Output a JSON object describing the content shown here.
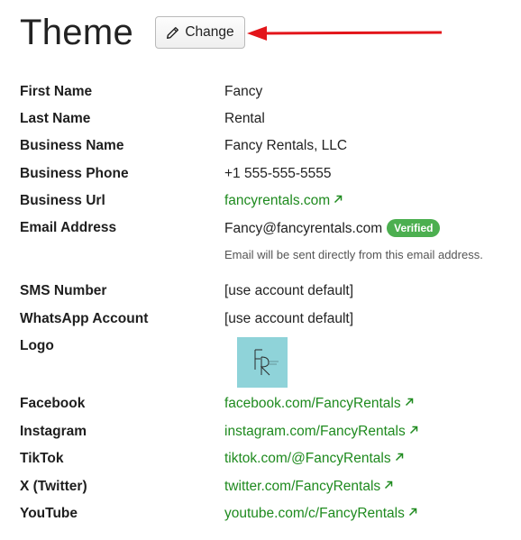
{
  "header": {
    "title": "Theme",
    "change_label": "Change"
  },
  "fields": [
    {
      "label": "First Name",
      "value": "Fancy"
    },
    {
      "label": "Last Name",
      "value": "Rental"
    },
    {
      "label": "Business Name",
      "value": "Fancy Rentals, LLC"
    },
    {
      "label": "Business Phone",
      "value": "+1 555-555-5555"
    },
    {
      "label": "Business Url",
      "value": "fancyrentals.com"
    },
    {
      "label": "Email Address",
      "value": "Fancy@fancyrentals.com",
      "badge": "Verified",
      "hint": "Email will be sent directly from this email address."
    },
    {
      "label": "SMS Number",
      "value": "[use account default]"
    },
    {
      "label": "WhatsApp Account",
      "value": "[use account default]"
    },
    {
      "label": "Logo"
    },
    {
      "label": "Facebook",
      "value": "facebook.com/FancyRentals"
    },
    {
      "label": "Instagram",
      "value": "instagram.com/FancyRentals"
    },
    {
      "label": "TikTok",
      "value": "tiktok.com/@FancyRentals"
    },
    {
      "label": "X (Twitter)",
      "value": "twitter.com/FancyRentals"
    },
    {
      "label": "YouTube",
      "value": "youtube.com/c/FancyRentals"
    }
  ],
  "colors": {
    "link": "#1e8a1e",
    "badge": "#4caf50",
    "arrow": "#e3151a",
    "logo_bg": "#8fd3d9"
  },
  "icons": {
    "change": "pencil-icon",
    "external": "external-link-icon"
  }
}
